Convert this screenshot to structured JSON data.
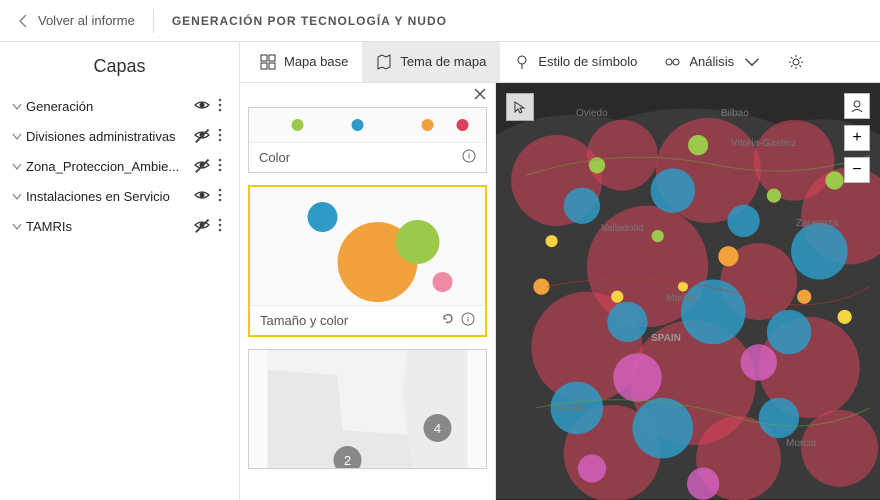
{
  "breadcrumb": {
    "back": "Volver al informe",
    "title": "GENERACIÓN POR TECNOLOGÍA Y NUDO"
  },
  "sidebar": {
    "title": "Capas",
    "layers": [
      {
        "label": "Generación",
        "visible": true
      },
      {
        "label": "Divisiones administrativas",
        "visible": false
      },
      {
        "label": "Zona_Proteccion_Ambie...",
        "visible": false
      },
      {
        "label": "Instalaciones en Servicio",
        "visible": true
      },
      {
        "label": "TAMRIs",
        "visible": false
      }
    ]
  },
  "toolbar": {
    "basemap": "Mapa base",
    "theme": "Tema de mapa",
    "symbol": "Estilo de símbolo",
    "analysis": "Análisis"
  },
  "theme_panel": {
    "cards": [
      {
        "name": "Color",
        "selected": false,
        "short": true
      },
      {
        "name": "Tamaño y color",
        "selected": true,
        "reset": true
      },
      {
        "name": "",
        "selected": false,
        "counts": [
          "4",
          "2"
        ]
      }
    ]
  },
  "map": {
    "labels": [
      "Oviedo",
      "Bilbao",
      "Vitoria-Gasteiz",
      "Valladolid",
      "Zaragoza",
      "Madrid",
      "SPAIN",
      "Sevilla",
      "Murcia"
    ],
    "zoom_in": "+",
    "zoom_out": "−"
  }
}
